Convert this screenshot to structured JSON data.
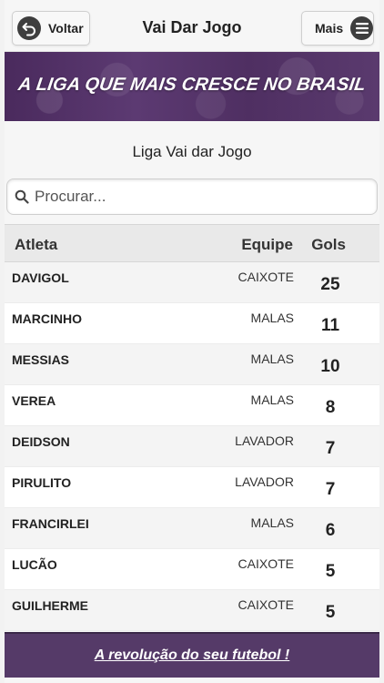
{
  "header": {
    "back_label": "Voltar",
    "title": "Vai Dar Jogo",
    "more_label": "Mais"
  },
  "banner": {
    "text": "A LIGA QUE MAIS CRESCE NO BRASIL"
  },
  "league": {
    "name": "Liga Vai dar Jogo"
  },
  "search": {
    "placeholder": "Procurar..."
  },
  "table": {
    "headers": {
      "athlete": "Atleta",
      "team": "Equipe",
      "goals": "Gols"
    },
    "rows": [
      {
        "athlete": "DAVIGOL",
        "team": "CAIXOTE",
        "goals": "25"
      },
      {
        "athlete": "MARCINHO",
        "team": "MALAS",
        "goals": "11"
      },
      {
        "athlete": "MESSIAS",
        "team": "MALAS",
        "goals": "10"
      },
      {
        "athlete": "VEREA",
        "team": "MALAS",
        "goals": "8"
      },
      {
        "athlete": "DEIDSON",
        "team": "LAVADOR",
        "goals": "7"
      },
      {
        "athlete": "PIRULITO",
        "team": "LAVADOR",
        "goals": "7"
      },
      {
        "athlete": "FRANCIRLEI",
        "team": "MALAS",
        "goals": "6"
      },
      {
        "athlete": "LUCÃO",
        "team": "CAIXOTE",
        "goals": "5"
      },
      {
        "athlete": "GUILHERME",
        "team": "CAIXOTE",
        "goals": "5"
      }
    ]
  },
  "footer": {
    "text": "A revolução do seu futebol !"
  },
  "icons": {
    "back": "back-arrow-icon",
    "menu": "hamburger-menu-icon",
    "search": "search-icon"
  },
  "colors": {
    "banner": "#553a68",
    "footer": "#553a68"
  }
}
